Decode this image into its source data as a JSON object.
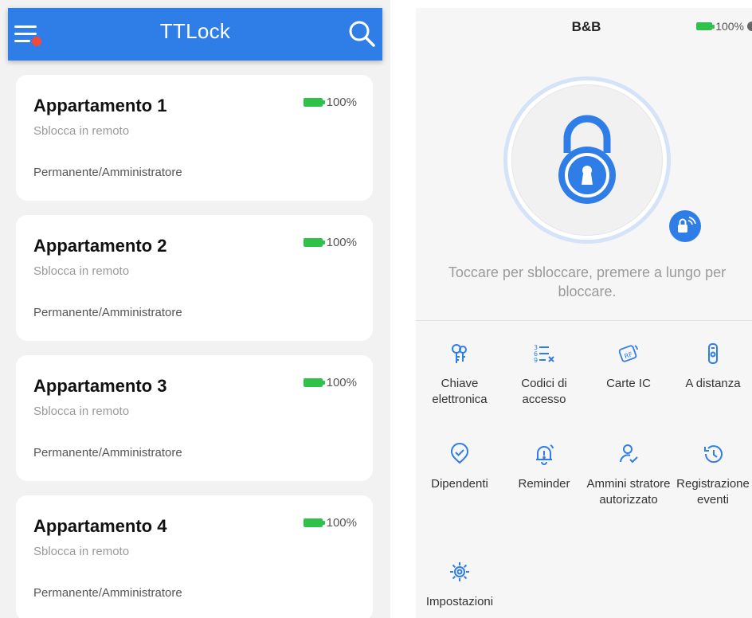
{
  "left": {
    "app_title": "TTLock",
    "locks": [
      {
        "name": "Appartamento 1",
        "mode": "Sblocca in remoto",
        "role": "Permanente/Amministratore",
        "battery": "100%"
      },
      {
        "name": "Appartamento 2",
        "mode": "Sblocca in remoto",
        "role": "Permanente/Amministratore",
        "battery": "100%"
      },
      {
        "name": "Appartamento 3",
        "mode": "Sblocca in remoto",
        "role": "Permanente/Amministratore",
        "battery": "100%"
      },
      {
        "name": "Appartamento 4",
        "mode": "Sblocca in remoto",
        "role": "Permanente/Amministratore",
        "battery": "100%"
      }
    ]
  },
  "right": {
    "title": "B&B",
    "battery": "100%",
    "hint": "Toccare per sbloccare, premere a lungo per bloccare.",
    "features": [
      {
        "label": "Chiave elettronica",
        "icon": "ekey-icon"
      },
      {
        "label": "Codici di accesso",
        "icon": "passcode-icon"
      },
      {
        "label": "Carte IC",
        "icon": "ic-card-icon"
      },
      {
        "label": "A distanza",
        "icon": "remote-icon"
      },
      {
        "label": "Dipendenti",
        "icon": "employees-icon"
      },
      {
        "label": "Reminder",
        "icon": "bell-icon"
      },
      {
        "label": "Ammini stratore autorizzato",
        "icon": "authorized-admin-icon"
      },
      {
        "label": "Registrazione eventi",
        "icon": "history-icon"
      },
      {
        "label": "Impostazioni",
        "icon": "settings-icon"
      }
    ]
  },
  "colors": {
    "primary": "#2f7de6",
    "battery": "#2fc24b",
    "notification_dot": "#f04a3a",
    "muted_text": "#9a9a9a"
  }
}
